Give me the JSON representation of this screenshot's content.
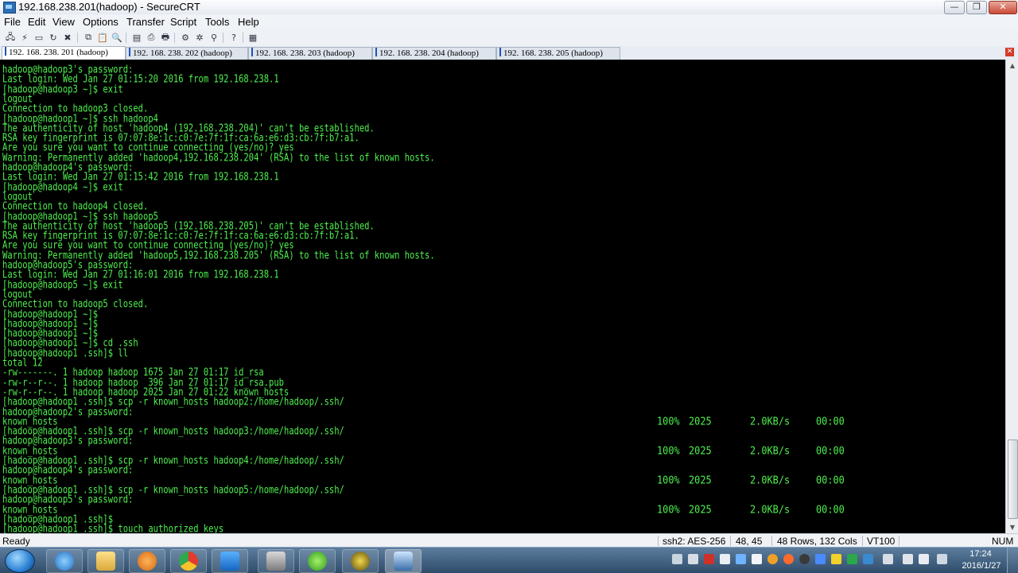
{
  "window": {
    "title": "192.168.238.201(hadoop) - SecureCRT",
    "min_glyph": "—",
    "max_glyph": "❐",
    "close_glyph": "✕"
  },
  "menu": [
    "File",
    "Edit",
    "View",
    "Options",
    "Transfer",
    "Script",
    "Tools",
    "Help"
  ],
  "toolbar_icons": [
    "connect-icon",
    "quick-connect-icon",
    "connect-tab-icon",
    "reconnect-icon",
    "disconnect-icon",
    "copy-icon",
    "paste-icon",
    "find-icon",
    "print-setup-icon",
    "print-icon",
    "print-screen-icon",
    "session-options-icon",
    "global-options-icon",
    "keymap-icon",
    "help-icon",
    "sftp-icon"
  ],
  "tabs": [
    {
      "label": "192. 168. 238. 201 (hadoop)",
      "active": true
    },
    {
      "label": "192. 168. 238. 202 (hadoop)",
      "active": false
    },
    {
      "label": "192. 168. 238. 203 (hadoop)",
      "active": false
    },
    {
      "label": "192. 168. 238. 204 (hadoop)",
      "active": false
    },
    {
      "label": "192. 168. 238. 205 (hadoop)",
      "active": false
    }
  ],
  "terminal": {
    "lines": [
      "hadoop@hadoop3's password:",
      "Last login: Wed Jan 27 01:15:20 2016 from 192.168.238.1",
      "[hadoop@hadoop3 ~]$ exit",
      "logout",
      "Connection to hadoop3 closed.",
      "[hadoop@hadoop1 ~]$ ssh hadoop4",
      "The authenticity of host 'hadoop4 (192.168.238.204)' can't be established.",
      "RSA key fingerprint is 07:07:8e:1c:c0:7e:7f:1f:ca:6a:e6:d3:cb:7f:b7:a1.",
      "Are you sure you want to continue connecting (yes/no)? yes",
      "Warning: Permanently added 'hadoop4,192.168.238.204' (RSA) to the list of known hosts.",
      "hadoop@hadoop4's password:",
      "Last login: Wed Jan 27 01:15:42 2016 from 192.168.238.1",
      "[hadoop@hadoop4 ~]$ exit",
      "logout",
      "Connection to hadoop4 closed.",
      "[hadoop@hadoop1 ~]$ ssh hadoop5",
      "The authenticity of host 'hadoop5 (192.168.238.205)' can't be established.",
      "RSA key fingerprint is 07:07:8e:1c:c0:7e:7f:1f:ca:6a:e6:d3:cb:7f:b7:a1.",
      "Are you sure you want to continue connecting (yes/no)? yes",
      "Warning: Permanently added 'hadoop5,192.168.238.205' (RSA) to the list of known hosts.",
      "hadoop@hadoop5's password:",
      "Last login: Wed Jan 27 01:16:01 2016 from 192.168.238.1",
      "[hadoop@hadoop5 ~]$ exit",
      "logout",
      "Connection to hadoop5 closed.",
      "[hadoop@hadoop1 ~]$",
      "[hadoop@hadoop1 ~]$",
      "[hadoop@hadoop1 ~]$",
      "[hadoop@hadoop1 ~]$ cd .ssh",
      "[hadoop@hadoop1 .ssh]$ ll",
      "total 12",
      "-rw-------. 1 hadoop hadoop 1675 Jan 27 01:17 id_rsa",
      "-rw-r--r--. 1 hadoop hadoop  396 Jan 27 01:17 id_rsa.pub",
      "-rw-r--r--. 1 hadoop hadoop 2025 Jan 27 01:22 known_hosts",
      "[hadoop@hadoop1 .ssh]$ scp -r known_hosts hadoop2:/home/hadoop/.ssh/",
      "hadoop@hadoop2's password:",
      "known_hosts",
      "[hadoop@hadoop1 .ssh]$ scp -r known_hosts hadoop3:/home/hadoop/.ssh/",
      "hadoop@hadoop3's password:",
      "known_hosts",
      "[hadoop@hadoop1 .ssh]$ scp -r known_hosts hadoop4:/home/hadoop/.ssh/",
      "hadoop@hadoop4's password:",
      "known_hosts",
      "[hadoop@hadoop1 .ssh]$ scp -r known_hosts hadoop5:/home/hadoop/.ssh/",
      "hadoop@hadoop5's password:",
      "known_hosts",
      "[hadoop@hadoop1 .ssh]$",
      "[hadoop@hadoop1 .ssh]$ touch authorized_keys"
    ],
    "transfers": [
      {
        "line": 36,
        "pct": "100%",
        "size": "2025",
        "rate": "2.0KB/s",
        "time": "00:00"
      },
      {
        "line": 39,
        "pct": "100%",
        "size": "2025",
        "rate": "2.0KB/s",
        "time": "00:00"
      },
      {
        "line": 42,
        "pct": "100%",
        "size": "2025",
        "rate": "2.0KB/s",
        "time": "00:00"
      },
      {
        "line": 45,
        "pct": "100%",
        "size": "2025",
        "rate": "2.0KB/s",
        "time": "00:00"
      }
    ],
    "text_color": "#4ef04e",
    "background": "#000000"
  },
  "status": {
    "ready": "Ready",
    "cipher": "ssh2: AES-256",
    "cursor": "48, 45",
    "size": "48 Rows, 132 Cols",
    "emulation": "VT100",
    "num": "NUM"
  },
  "taskbar": {
    "apps": [
      "internet-explorer-icon",
      "file-explorer-icon",
      "media-player-icon",
      "chrome-icon",
      "outlook-icon",
      "lock-app-icon",
      "green-app-icon",
      "winrar-icon",
      "securecrt-icon"
    ],
    "time": "17:24",
    "date": "2016/1/27"
  }
}
